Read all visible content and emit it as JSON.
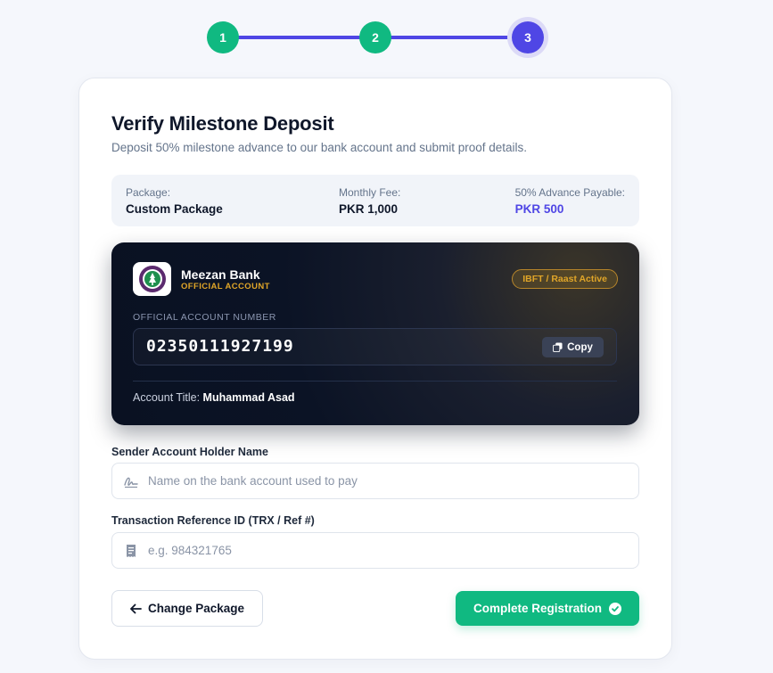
{
  "stepper": {
    "steps": [
      {
        "label": "1",
        "state": "done"
      },
      {
        "label": "2",
        "state": "done"
      },
      {
        "label": "3",
        "state": "active"
      }
    ]
  },
  "header": {
    "title": "Verify Milestone Deposit",
    "subtitle": "Deposit 50% milestone advance to our bank account and submit proof details."
  },
  "summary": {
    "package_label": "Package:",
    "package_value": "Custom Package",
    "fee_label": "Monthly Fee:",
    "fee_value": "PKR 1,000",
    "advance_label": "50% Advance Payable:",
    "advance_value": "PKR 500"
  },
  "bank": {
    "name": "Meezan Bank",
    "tag": "OFFICIAL ACCOUNT",
    "badge": "IBFT / Raast Active",
    "account_label": "OFFICIAL ACCOUNT NUMBER",
    "account_number": "02350111927199",
    "copy_label": "Copy",
    "title_label": "Account Title:",
    "title_value": "Muhammad Asad"
  },
  "form": {
    "sender_label": "Sender Account Holder Name",
    "sender_placeholder": "Name on the bank account used to pay",
    "sender_value": "",
    "trx_label": "Transaction Reference ID (TRX / Ref #)",
    "trx_placeholder": "e.g. 984321765",
    "trx_value": ""
  },
  "actions": {
    "back_label": "Change Package",
    "submit_label": "Complete Registration"
  },
  "colors": {
    "accent": "#4f46e5",
    "success": "#10b981",
    "gold": "#e0a528",
    "bank_bg": "#0b1325"
  }
}
